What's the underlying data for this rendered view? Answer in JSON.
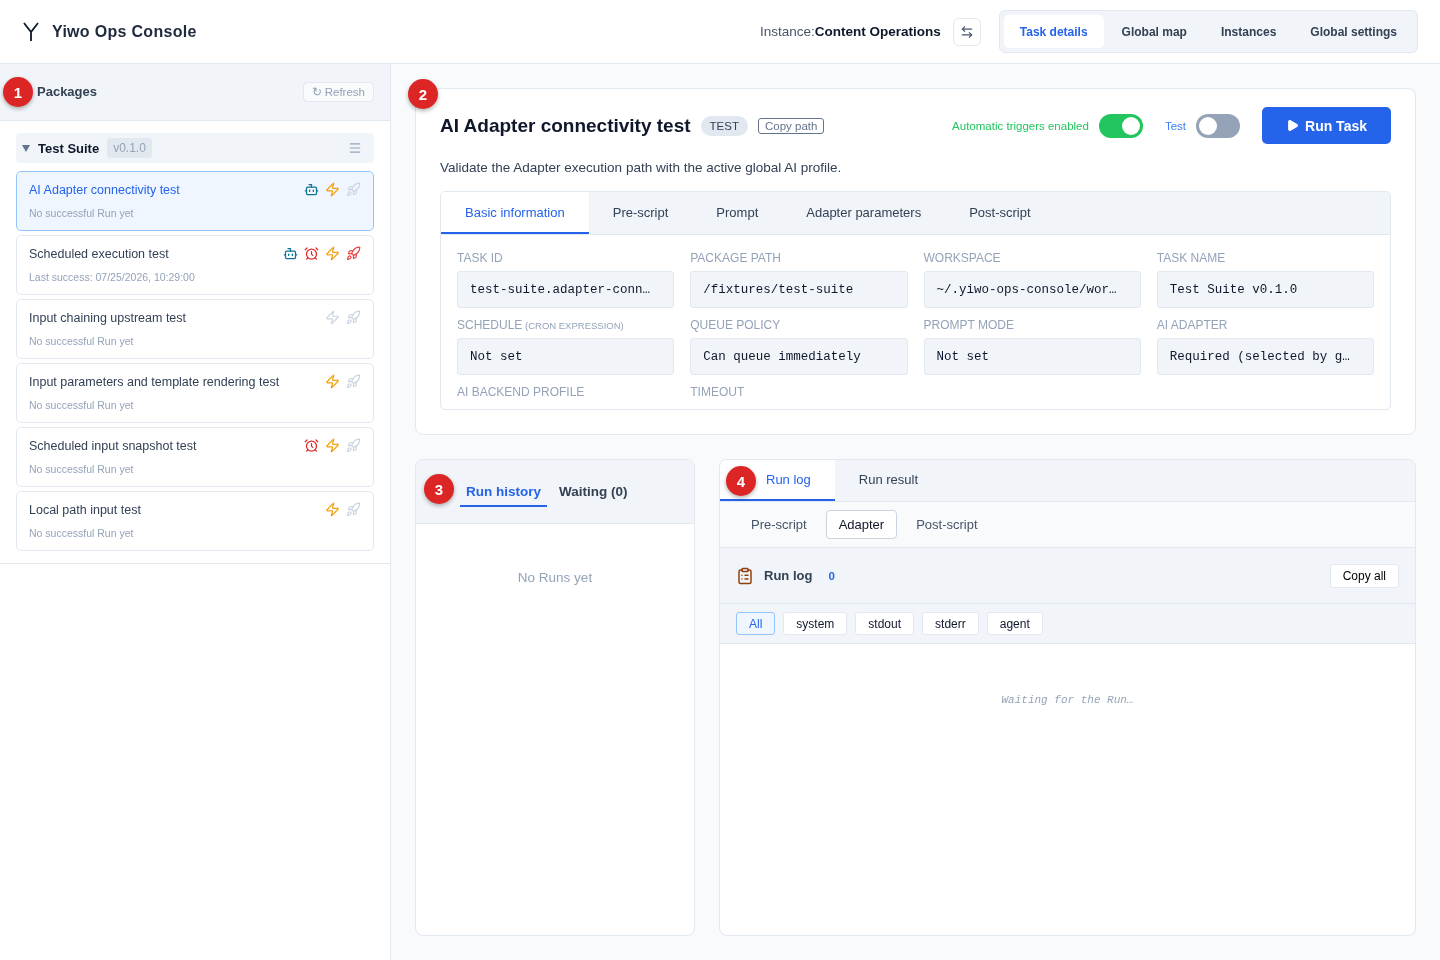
{
  "app": {
    "title": "Yiwo Ops Console"
  },
  "header": {
    "instance_label": "Instance:",
    "instance_name": "Content Operations",
    "nav_tabs": [
      {
        "label": "Task details",
        "selected": true
      },
      {
        "label": "Global map",
        "selected": false
      },
      {
        "label": "Instances",
        "selected": false
      },
      {
        "label": "Global settings",
        "selected": false
      }
    ]
  },
  "sidebar": {
    "callout": "1",
    "title": "Packages",
    "refresh": "↻ Refresh",
    "package": {
      "name": "Test Suite",
      "version": "v0.1.0",
      "expanded": true,
      "tasks": [
        {
          "name": "AI Adapter connectivity test",
          "status": "No successful Run yet",
          "selected": true,
          "icons": [
            {
              "kind": "robot",
              "active": true
            },
            {
              "kind": "bolt",
              "active": true
            },
            {
              "kind": "rocket",
              "active": false
            }
          ]
        },
        {
          "name": "Scheduled execution test",
          "status": "Last success: 07/25/2026, 10:29:00",
          "selected": false,
          "icons": [
            {
              "kind": "robot",
              "active": true
            },
            {
              "kind": "alarm",
              "active": true
            },
            {
              "kind": "bolt",
              "active": true
            },
            {
              "kind": "rocket",
              "active": true
            }
          ]
        },
        {
          "name": "Input chaining upstream test",
          "status": "No successful Run yet",
          "selected": false,
          "icons": [
            {
              "kind": "bolt",
              "active": false
            },
            {
              "kind": "rocket",
              "active": false
            }
          ]
        },
        {
          "name": "Input parameters and template rendering test",
          "status": "No successful Run yet",
          "selected": false,
          "icons": [
            {
              "kind": "bolt",
              "active": true
            },
            {
              "kind": "rocket",
              "active": false
            }
          ]
        },
        {
          "name": "Scheduled input snapshot test",
          "status": "No successful Run yet",
          "selected": false,
          "icons": [
            {
              "kind": "alarm",
              "active": true
            },
            {
              "kind": "bolt",
              "active": true
            },
            {
              "kind": "rocket",
              "active": false
            }
          ]
        },
        {
          "name": "Local path input test",
          "status": "No successful Run yet",
          "selected": false,
          "icons": [
            {
              "kind": "bolt",
              "active": true
            },
            {
              "kind": "rocket",
              "active": false
            }
          ]
        }
      ]
    }
  },
  "task": {
    "callout": "2",
    "title": "AI Adapter connectivity test",
    "tag": "TEST",
    "copy_path": "Copy path",
    "auto_triggers": {
      "label": "Automatic triggers enabled",
      "on": true
    },
    "test_mode": {
      "label": "Test",
      "on": false
    },
    "run_button": "Run Task",
    "description": "Validate the Adapter execution path with the active global AI profile.",
    "tabs": [
      {
        "label": "Basic information",
        "selected": true
      },
      {
        "label": "Pre-script",
        "selected": false
      },
      {
        "label": "Prompt",
        "selected": false
      },
      {
        "label": "Adapter parameters",
        "selected": false
      },
      {
        "label": "Post-script",
        "selected": false
      }
    ],
    "fields": [
      {
        "label": "TASK ID",
        "value": "test-suite.adapter-conn…"
      },
      {
        "label": "PACKAGE PATH",
        "value": "/fixtures/test-suite"
      },
      {
        "label": "WORKSPACE",
        "value": "~/.yiwo-ops-console/wor…"
      },
      {
        "label": "TASK NAME",
        "value": "Test Suite v0.1.0"
      },
      {
        "label": "SCHEDULE",
        "hint": "(CRON EXPRESSION)",
        "value": "Not set"
      },
      {
        "label": "QUEUE POLICY",
        "value": "Can queue immediately"
      },
      {
        "label": "PROMPT MODE",
        "value": "Not set"
      },
      {
        "label": "AI ADAPTER",
        "value": "Required (selected by g…"
      },
      {
        "label": "AI BACKEND PROFILE"
      },
      {
        "label": "TIMEOUT"
      }
    ]
  },
  "history": {
    "callout": "3",
    "tabs": [
      {
        "label": "Run history",
        "selected": true
      },
      {
        "label": "Waiting (0)",
        "selected": false
      }
    ],
    "empty": "No Runs yet"
  },
  "log": {
    "callout": "4",
    "tabs": [
      {
        "label": "Run log",
        "selected": true
      },
      {
        "label": "Run result",
        "selected": false
      }
    ],
    "phases": [
      {
        "label": "Pre-script",
        "selected": false
      },
      {
        "label": "Adapter",
        "selected": true
      },
      {
        "label": "Post-script",
        "selected": false
      }
    ],
    "title": "Run log",
    "count": "0",
    "copy": "Copy all",
    "filters": [
      {
        "label": "All",
        "selected": true
      },
      {
        "label": "system",
        "selected": false
      },
      {
        "label": "stdout",
        "selected": false
      },
      {
        "label": "stderr",
        "selected": false
      },
      {
        "label": "agent",
        "selected": false
      }
    ],
    "empty": "Waiting for the Run…"
  }
}
